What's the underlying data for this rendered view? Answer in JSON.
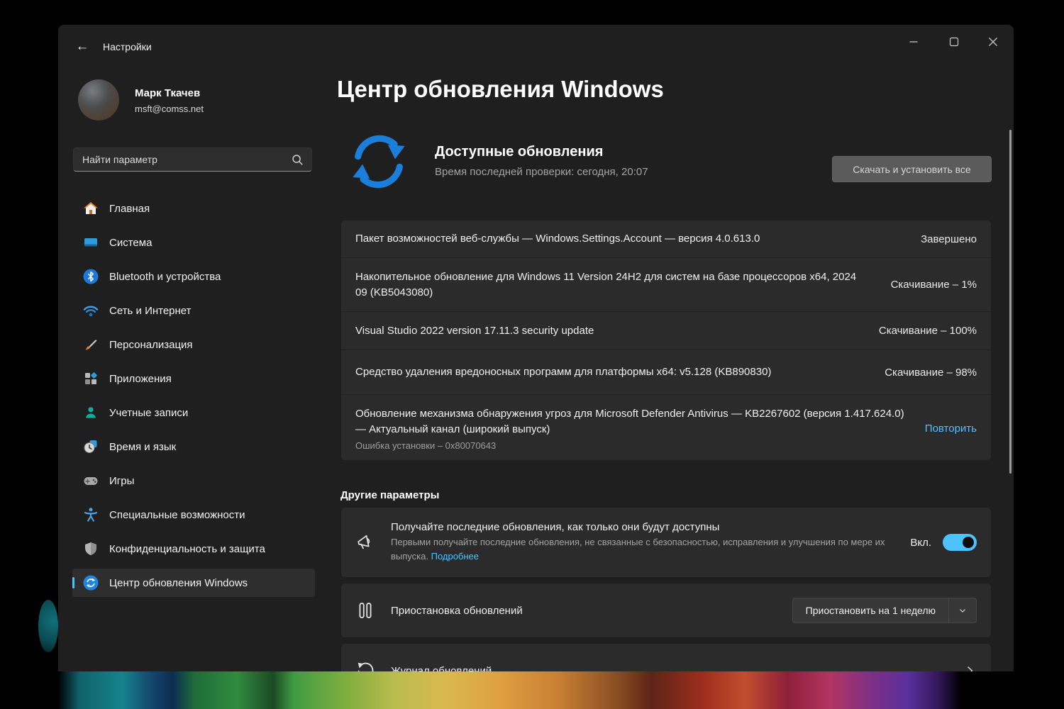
{
  "window": {
    "app_title": "Настройки",
    "page_title": "Центр обновления Windows"
  },
  "user": {
    "name": "Марк Ткачев",
    "email": "msft@comss.net"
  },
  "search": {
    "placeholder": "Найти параметр"
  },
  "sidebar": {
    "items": [
      {
        "label": "Главная"
      },
      {
        "label": "Система"
      },
      {
        "label": "Bluetooth и устройства"
      },
      {
        "label": "Сеть и Интернет"
      },
      {
        "label": "Персонализация"
      },
      {
        "label": "Приложения"
      },
      {
        "label": "Учетные записи"
      },
      {
        "label": "Время и язык"
      },
      {
        "label": "Игры"
      },
      {
        "label": "Специальные возможности"
      },
      {
        "label": "Конфиденциальность и защита"
      },
      {
        "label": "Центр обновления Windows"
      }
    ]
  },
  "hero": {
    "title": "Доступные обновления",
    "subtitle": "Время последней проверки: сегодня, 20:07",
    "action_label": "Скачать и установить все"
  },
  "updates": [
    {
      "name": "Пакет возможностей веб-службы — Windows.Settings.Account — версия 4.0.613.0",
      "status": "Завершено"
    },
    {
      "name": "Накопительное обновление для Windows 11 Version 24H2 для систем на базе процессоров x64, 2024 09 (KB5043080)",
      "status": "Скачивание – 1%"
    },
    {
      "name": "Visual Studio 2022 version 17.11.3 security update",
      "status": "Скачивание – 100%"
    },
    {
      "name": "Средство удаления вредоносных программ для платформы x64: v5.128 (KB890830)",
      "status": "Скачивание – 98%"
    },
    {
      "name": "Обновление механизма обнаружения угроз для Microsoft Defender Antivirus — KB2267602 (версия 1.417.624.0) — Актуальный канал (широкий выпуск)",
      "error": "Ошибка установки – 0x80070643",
      "action": "Повторить"
    }
  ],
  "other": {
    "heading": "Другие параметры",
    "latest": {
      "title": "Получайте последние обновления, как только они будут доступны",
      "description": "Первыми получайте последние обновления, не связанные с безопасностью, исправления и улучшения по мере их выпуска.",
      "link_label": "Подробнее",
      "toggle_label": "Вкл."
    },
    "pause": {
      "title": "Приостановка обновлений",
      "button_label": "Приостановить на 1 неделю"
    },
    "history": {
      "title": "Журнал обновлений"
    }
  },
  "colors": {
    "accent": "#4cc2ff",
    "update_blue": "#1b7edb"
  }
}
